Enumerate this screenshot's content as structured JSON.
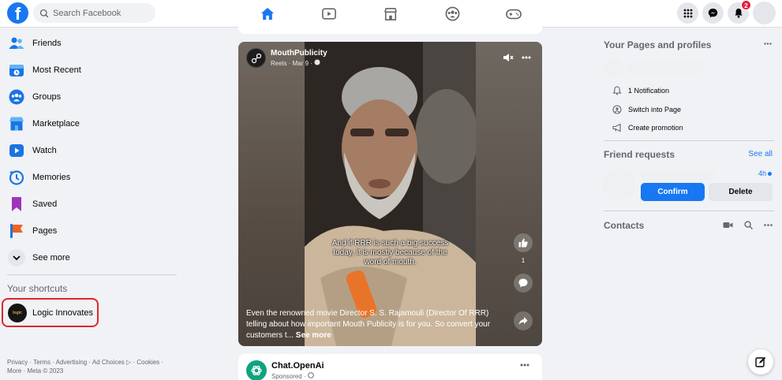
{
  "colors": {
    "brand": "#1877f2",
    "notification": "#e41e3f",
    "highlight_border": "#e0262b"
  },
  "topbar": {
    "logo_letter": "f",
    "search_placeholder": "Search Facebook",
    "tabs": [
      "home-icon",
      "watch-icon",
      "marketplace-icon",
      "groups-icon",
      "gaming-icon"
    ],
    "active_tab": "home-icon",
    "notification_count": "2"
  },
  "sidebar": {
    "items": [
      {
        "label": "Friends",
        "icon": "friends-icon"
      },
      {
        "label": "Most Recent",
        "icon": "most-recent-icon"
      },
      {
        "label": "Groups",
        "icon": "groups-icon"
      },
      {
        "label": "Marketplace",
        "icon": "marketplace-icon"
      },
      {
        "label": "Watch",
        "icon": "watch-icon"
      },
      {
        "label": "Memories",
        "icon": "memories-icon"
      },
      {
        "label": "Saved",
        "icon": "saved-icon"
      },
      {
        "label": "Pages",
        "icon": "pages-icon"
      },
      {
        "label": "See more",
        "icon": "chevron-down-icon"
      }
    ],
    "shortcuts_title": "Your shortcuts",
    "shortcut": {
      "label": "Logic Innovates",
      "logo_text": "logic"
    },
    "footer": "Privacy · Terms · Advertising · Ad Choices ▷ · Cookies · More · Meta © 2023"
  },
  "feed": {
    "reel": {
      "author": "MouthPublicity",
      "meta": "Reels · Mar 9 ·",
      "subtitle_line1": "And if RRR is such a big success",
      "subtitle_line2": "today, it is mostly because of the",
      "subtitle_line3": "word of mouth.",
      "like_count": "1",
      "caption": "Even the renowned movie Director S. S. Rajamouli (Director Of RRR) telling about how important Mouth Publicity is for you. So convert your customers t...",
      "see_more": "See more"
    },
    "next_post": {
      "author": "Chat.OpenAi",
      "meta": "Sponsored ·"
    }
  },
  "right": {
    "pages_title": "Your Pages and profiles",
    "page_actions": [
      {
        "label": "1 Notification",
        "icon": "bell-outline-icon"
      },
      {
        "label": "Switch into Page",
        "icon": "switch-profile-icon"
      },
      {
        "label": "Create promotion",
        "icon": "megaphone-icon"
      }
    ],
    "friend_requests_title": "Friend requests",
    "see_all": "See all",
    "request_time": "4h",
    "confirm_label": "Confirm",
    "delete_label": "Delete",
    "contacts_title": "Contacts"
  }
}
